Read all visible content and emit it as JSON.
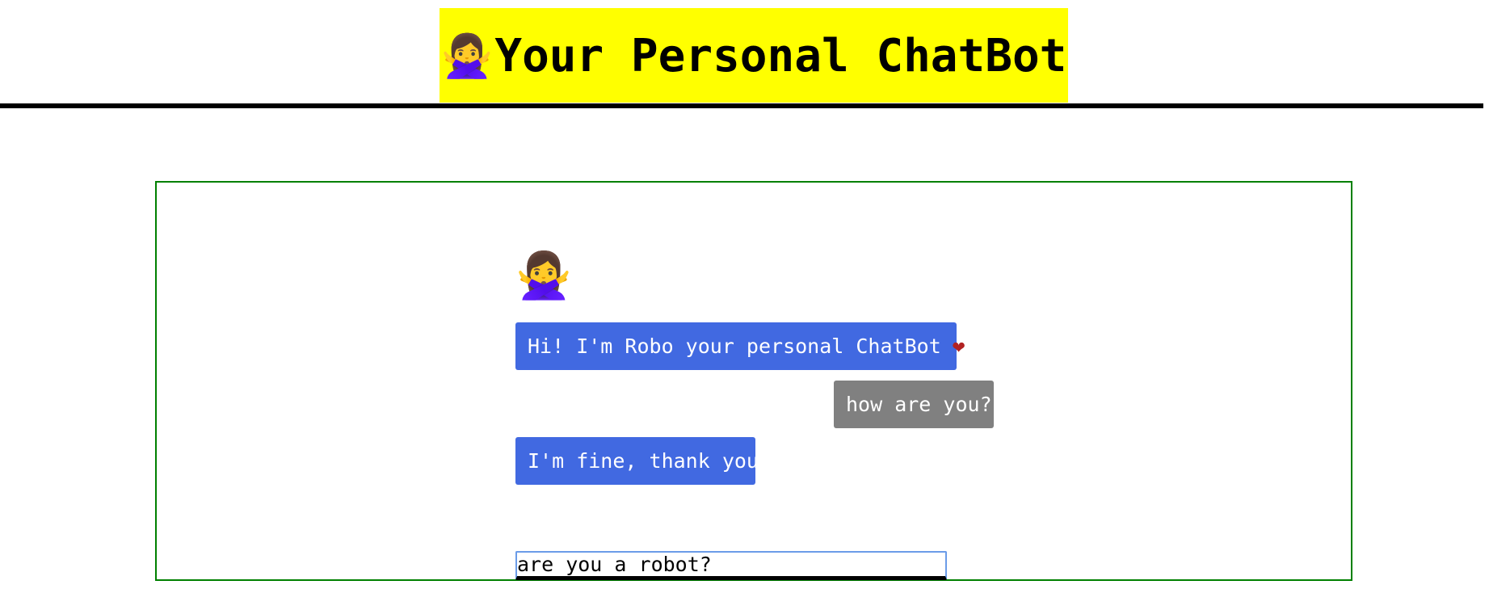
{
  "header": {
    "emoji": "🙅‍♀️",
    "title": "Your Personal ChatBot",
    "background_color": "#ffff00"
  },
  "chat": {
    "avatar": "🙅‍♀️",
    "messages": [
      {
        "sender": "bot",
        "text": "Hi! I'm Robo your personal ChatBot",
        "suffix_icon": "❤",
        "color": "#4169e1"
      },
      {
        "sender": "user",
        "text": "how are you?",
        "color": "#808080"
      },
      {
        "sender": "bot",
        "text": "I'm fine, thank you",
        "color": "#4169e1"
      }
    ],
    "border_color": "#008000"
  },
  "input": {
    "value": "are you a robot?"
  }
}
